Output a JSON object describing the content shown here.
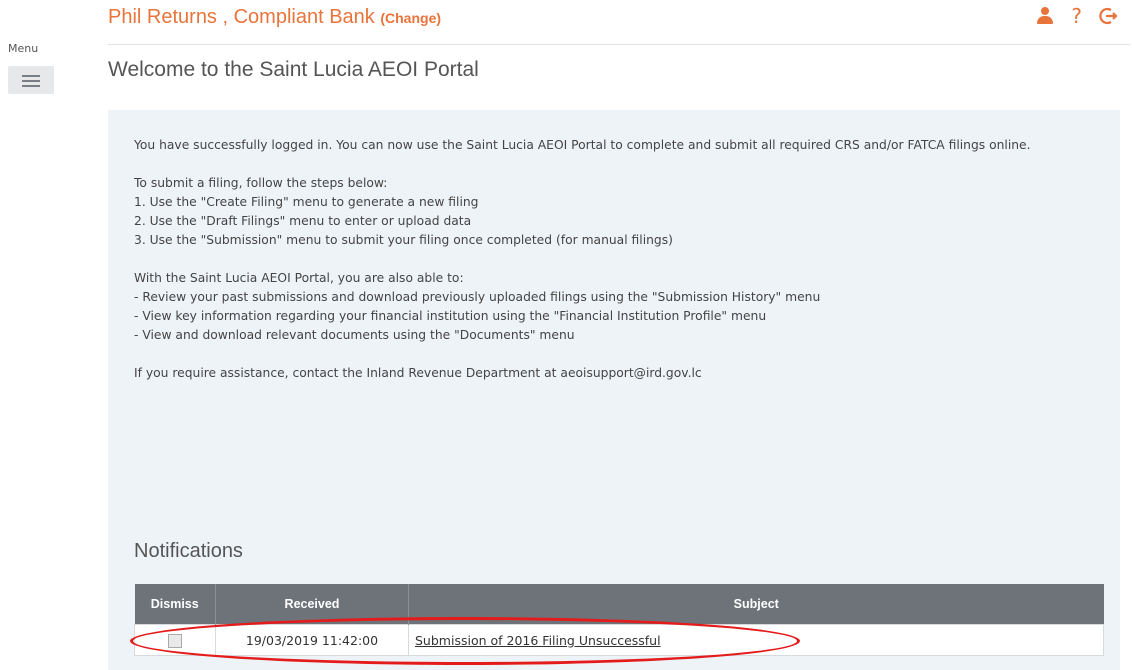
{
  "menu": {
    "label": "Menu"
  },
  "header": {
    "user_text": "Phil Returns , Compliant Bank",
    "change_label": "(Change)",
    "help_glyph": "?",
    "icons": [
      "user-icon",
      "help-icon",
      "logout-icon"
    ],
    "accent_color": "#e8743b"
  },
  "page_title": "Welcome to the Saint Lucia AEOI Portal",
  "intro": {
    "paragraph1": "You have successfully logged in. You can now use the Saint Lucia AEOI Portal to complete and submit all required CRS and/or FATCA filings online.",
    "steps_heading": "To submit a filing, follow the steps below:",
    "steps": [
      "1. Use the \"Create Filing\" menu to generate a new filing",
      "2. Use the \"Draft Filings\" menu to enter or upload data",
      "3. Use the \"Submission\" menu to submit your filing once completed (for manual filings)"
    ],
    "abilities_heading": "With the Saint Lucia AEOI Portal, you are also able to:",
    "abilities": [
      "- Review your past submissions and download previously uploaded filings using the \"Submission History\" menu",
      "- View key information regarding your financial institution using the \"Financial Institution Profile\" menu",
      "- View and download relevant documents using the \"Documents\" menu"
    ],
    "assistance": "If you require assistance, contact the Inland Revenue Department at aeoisupport@ird.gov.lc"
  },
  "notifications": {
    "title": "Notifications",
    "columns": [
      "Dismiss",
      "Received",
      "Subject"
    ],
    "rows": [
      {
        "received": "19/03/2019 11:42:00",
        "subject": "Submission of 2016 Filing Unsuccessful"
      }
    ],
    "highlight_color": "#e41b1b"
  }
}
